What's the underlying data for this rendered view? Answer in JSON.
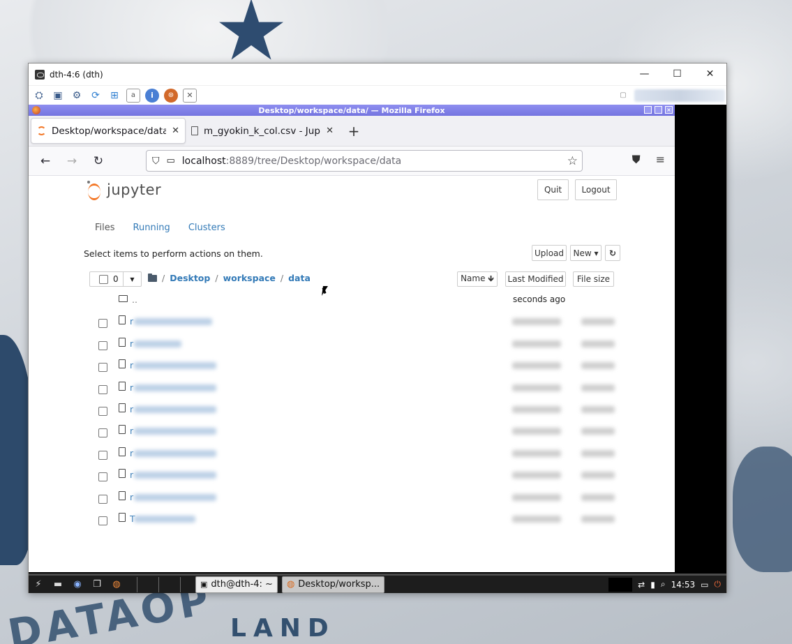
{
  "outer_window": {
    "title": "dth-4:6 (dth)",
    "minimize": "—",
    "maximize": "☐",
    "close": "✕"
  },
  "vnc_toolbar": {
    "icons": [
      "settings-icon",
      "fullscreen-icon",
      "gear-icon",
      "refresh-icon",
      "windows-key-icon",
      "keyboard-icon",
      "info-icon",
      "ball-icon",
      "disconnect-icon"
    ]
  },
  "browser": {
    "window_title": "Desktop/workspace/data/ — Mozilla Firefox",
    "tabs": [
      {
        "label": "Desktop/workspace/data/",
        "close": "✕"
      },
      {
        "label": "m_gyokin_k_col.csv - Jup",
        "close": "✕"
      }
    ],
    "new_tab": "+",
    "url_host": "localhost",
    "url_path": ":8889/tree/Desktop/workspace/data"
  },
  "jupyter": {
    "logo_text": "jupyter",
    "quit_label": "Quit",
    "logout_label": "Logout",
    "tabs": [
      "Files",
      "Running",
      "Clusters"
    ],
    "hint": "Select items to perform actions on them.",
    "upload_label": "Upload",
    "new_label": "New ▾",
    "refresh_icon": "↻",
    "selected_count": "0",
    "breadcrumbs": [
      "Desktop",
      "workspace",
      "data"
    ],
    "sort_name_label": "Name 🡻",
    "sort_modified_label": "Last Modified",
    "sort_size_label": "File size",
    "parent_dir": {
      "name": "..",
      "modified": "seconds ago"
    },
    "files": [
      {
        "initial": "r"
      },
      {
        "initial": "r"
      },
      {
        "initial": "r"
      },
      {
        "initial": "r"
      },
      {
        "initial": "r"
      },
      {
        "initial": "r"
      },
      {
        "initial": "r"
      },
      {
        "initial": "r"
      },
      {
        "initial": "r"
      },
      {
        "initial": "T"
      }
    ]
  },
  "taskbar": {
    "tasks": [
      {
        "label": "dth@dth-4: ~"
      },
      {
        "label": "Desktop/worksp..."
      }
    ],
    "clock": "14:53"
  }
}
